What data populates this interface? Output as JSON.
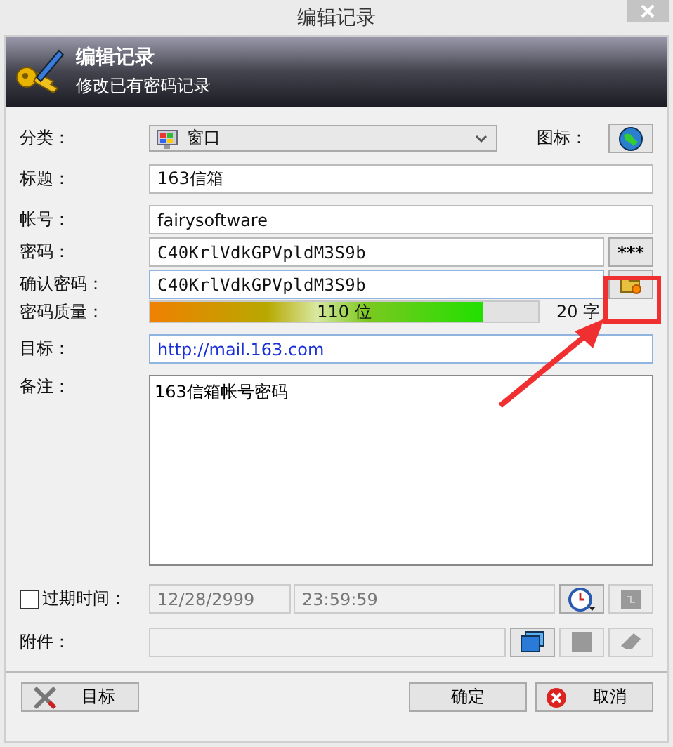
{
  "window": {
    "title": "编辑记录"
  },
  "header": {
    "title": "编辑记录",
    "subtitle": "修改已有密码记录"
  },
  "category": {
    "label": "分类：",
    "value": "窗口",
    "icon_label": "图标："
  },
  "title_field": {
    "label": "标题：",
    "value": "163信箱"
  },
  "account": {
    "label": "帐号：",
    "value": "fairysoftware"
  },
  "password": {
    "label": "密码：",
    "value": "C40KrlVdkGPVpldM3S9b",
    "toggle": "***"
  },
  "confirm": {
    "label": "确认密码：",
    "value": "C40KrlVdkGPVpldM3S9b"
  },
  "quality": {
    "label": "密码质量：",
    "level": 0.86,
    "reading": "110 位",
    "length": "20 字"
  },
  "target": {
    "label": "目标：",
    "value": "http://mail.163.com"
  },
  "notes": {
    "label": "备注：",
    "value": "163信箱帐号密码"
  },
  "expiry": {
    "label": "过期时间：",
    "checked": false,
    "date": "12/28/2999",
    "time": "23:59:59"
  },
  "attachment": {
    "label": "附件："
  },
  "buttons": [
    {
      "label": "目标",
      "kind": "tools"
    },
    {
      "label": "确定",
      "kind": "ok"
    },
    {
      "label": "取消",
      "kind": "cancel"
    }
  ]
}
